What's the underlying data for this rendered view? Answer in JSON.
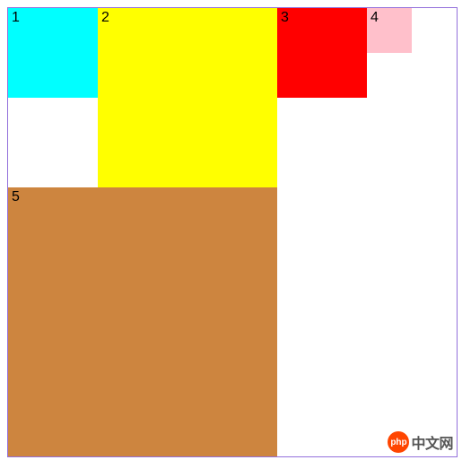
{
  "boxes": {
    "b1": {
      "label": "1",
      "color": "#00ffff"
    },
    "b2": {
      "label": "2",
      "color": "#ffff00"
    },
    "b3": {
      "label": "3",
      "color": "#ff0000"
    },
    "b4": {
      "label": "4",
      "color": "#ffc0cb"
    },
    "b5": {
      "label": "5",
      "color": "#cd853f"
    }
  },
  "watermark": {
    "logo_text": "php",
    "text": "中文网"
  }
}
